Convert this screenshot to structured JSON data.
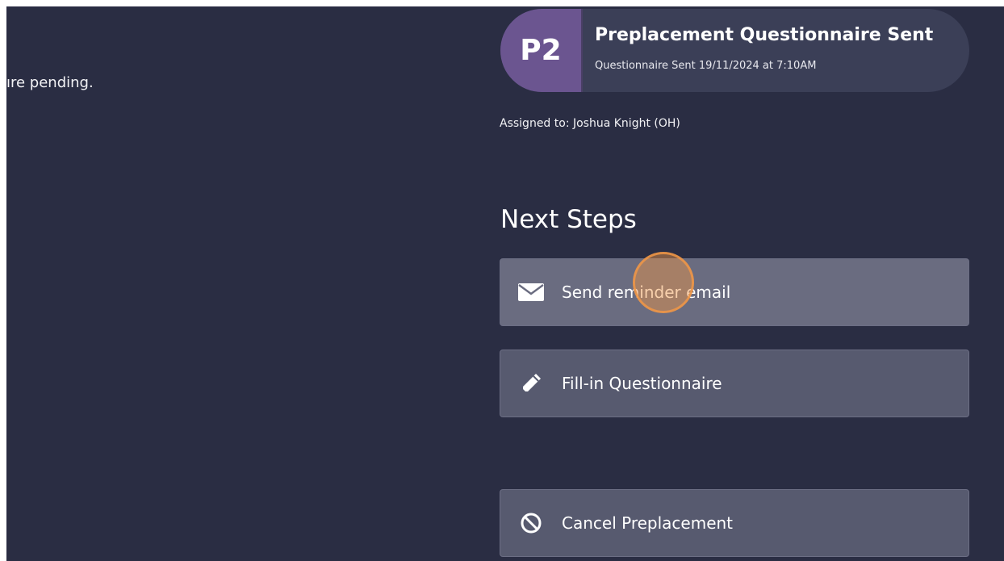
{
  "left_panel": {
    "text_fragment": "ıre pending."
  },
  "status_card": {
    "code": "P2",
    "title": "Preplacement Questionnaire Sent",
    "subtitle": "Questionnaire Sent 19/11/2024 at 7:10AM"
  },
  "assignment": {
    "text": "Assigned to: Joshua Knight (OH)"
  },
  "next_steps": {
    "heading": "Next Steps",
    "actions": [
      {
        "label": "Send reminder email",
        "icon": "envelope-icon"
      },
      {
        "label": "Fill-in Questionnaire",
        "icon": "pencil-icon"
      },
      {
        "label": "Cancel Preplacement",
        "icon": "ban-icon"
      }
    ]
  },
  "colors": {
    "background": "#2a2d43",
    "status_code_bg": "#6b5590",
    "status_card_bg": "#3b3f57",
    "button_bg": "#575a6f",
    "button_active_bg": "#6a6c80",
    "click_marker": "#f0964a"
  }
}
